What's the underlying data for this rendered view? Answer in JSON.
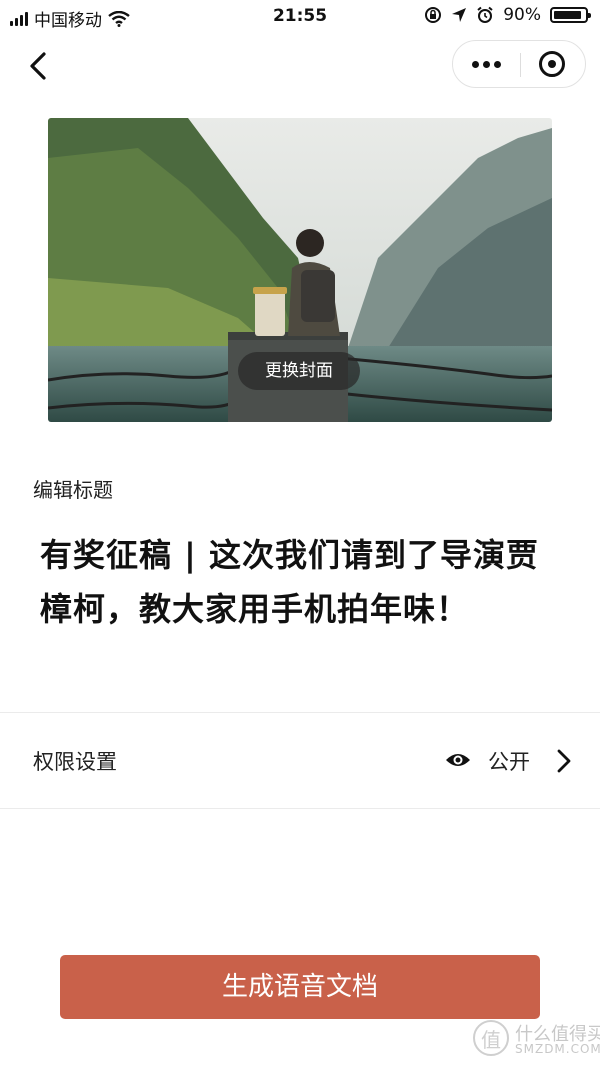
{
  "status_bar": {
    "carrier": "中国移动",
    "time": "21:55",
    "battery_text": "90%",
    "battery_level": 0.9,
    "icons": [
      "signal-icon",
      "wifi-icon",
      "orientation-lock-icon",
      "location-icon",
      "alarm-icon",
      "battery-icon"
    ]
  },
  "nav": {
    "back_icon": "chevron-left-icon",
    "more_icon": "more-dots-icon",
    "close_icon": "target-icon"
  },
  "cover": {
    "change_label": "更换封面"
  },
  "title_section": {
    "label": "编辑标题",
    "title": "有奖征稿 | 这次我们请到了导演贾樟柯，教大家用手机拍年味！"
  },
  "permission": {
    "label": "权限设置",
    "value": "公开",
    "icons": [
      "eye-icon",
      "chevron-right-icon"
    ]
  },
  "primary_action": {
    "label": "生成语音文档",
    "color": "#c9614a"
  },
  "watermark": {
    "logo": "值",
    "text": "什么值得买",
    "sub": "SMZDM.COM"
  }
}
